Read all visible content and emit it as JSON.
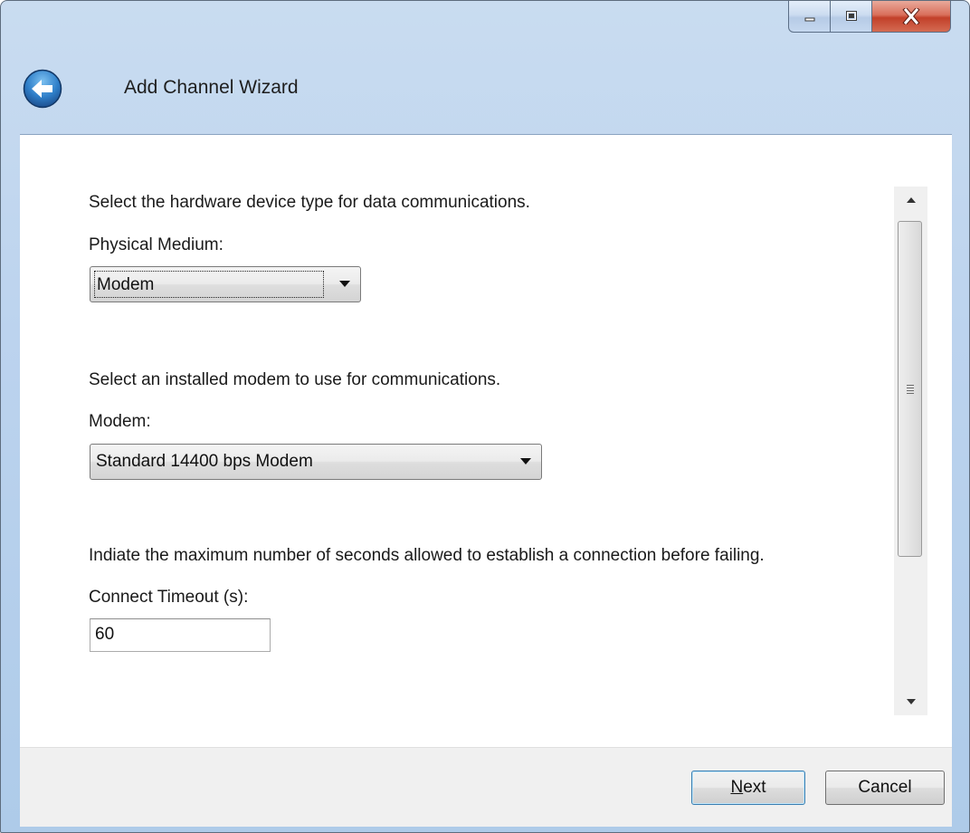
{
  "window": {
    "title": "Add Channel Wizard",
    "caption_icons": [
      "minimize-icon",
      "maximize-icon",
      "close-icon"
    ],
    "back_icon": "back-arrow-icon",
    "accent": "#3f8fd2",
    "close_color": "#c7432c"
  },
  "step1": {
    "prompt": "Select the hardware device type for data communications.",
    "label": "Physical Medium:",
    "selected": "Modem"
  },
  "step2": {
    "prompt": "Select an installed modem to use for communications.",
    "label": "Modem:",
    "selected": "Standard 14400 bps Modem"
  },
  "step3": {
    "prompt": "Indiate the maximum number of seconds allowed to establish a connection before failing.",
    "label": "Connect Timeout (s):",
    "value": "60"
  },
  "buttons": {
    "next_mnemonic": "N",
    "next_rest": "ext",
    "cancel": "Cancel"
  }
}
